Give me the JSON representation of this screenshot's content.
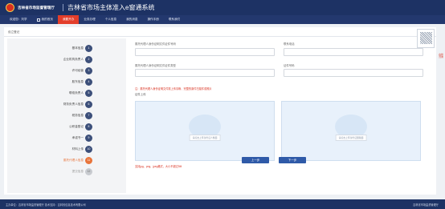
{
  "header": {
    "org_name": "吉林省市场监督管理厅",
    "system_title": "吉林省市场主体准入e窗通系统",
    "user_text": ""
  },
  "nav": {
    "items": [
      {
        "label": "欢迎您：刘学"
      },
      {
        "label": "我的首页"
      },
      {
        "label": "我要开办"
      },
      {
        "label": "业务办理"
      },
      {
        "label": "个人信息"
      },
      {
        "label": "我的消息"
      },
      {
        "label": "操作手册"
      },
      {
        "label": "联系我们"
      }
    ],
    "active_index": 2
  },
  "breadcrumb": "设立登记",
  "steps": [
    {
      "label": "基本信息",
      "num": "1",
      "state": "done"
    },
    {
      "label": "企业机构负责人",
      "num": "2",
      "state": "done"
    },
    {
      "label": "许可经营",
      "num": "3",
      "state": "done"
    },
    {
      "label": "股东信息",
      "num": "4",
      "state": "done"
    },
    {
      "label": "联络负责人",
      "num": "5",
      "state": "done"
    },
    {
      "label": "财务负责人信息",
      "num": "6",
      "state": "done"
    },
    {
      "label": "税务信息",
      "num": "7",
      "state": "done"
    },
    {
      "label": "公积金登记",
      "num": "8",
      "state": "done"
    },
    {
      "label": "承诺书一",
      "num": "9",
      "state": "done"
    },
    {
      "label": "材料上传",
      "num": "10",
      "state": "done"
    },
    {
      "label": "委托代理人信息",
      "num": "11",
      "state": "current"
    },
    {
      "label": "提交信息",
      "num": "12",
      "state": "pending"
    }
  ],
  "form": {
    "agent_id_label": "委托代理人身份证明文件证件号码",
    "agent_id_value": "",
    "phone_label": "联系电话",
    "phone_value": "",
    "agent_type_label": "委托代理人身份证明文件证件类型",
    "agent_type_value": "",
    "cert_no_label": "证件号码",
    "cert_no_value": "",
    "note": "注：委托代理人身份证明文件需上传清晰、完整的原件扫描件或照片",
    "upload_title": "证件上传",
    "upload_front_caption": "请点击上传身份证人像面",
    "upload_back_caption": "请点击上传身份证国徽面",
    "upload_note": "支持jpg、png、jpeg格式，大小不超过5M",
    "prev_label": "上一步",
    "next_label": "下一步"
  },
  "side": {
    "widget_label": "",
    "tab_label": "在线咨询"
  },
  "footer": {
    "left": "主办单位：吉林省市场监督管理厅 技术支持：吉林省信息技术有限公司",
    "right": "吉林省市场监督管理厅"
  },
  "colors": {
    "header_bg": "#1d3264",
    "active_nav": "#e33e2b",
    "current_step": "#e8743b",
    "primary_button": "#2f5aa8"
  }
}
